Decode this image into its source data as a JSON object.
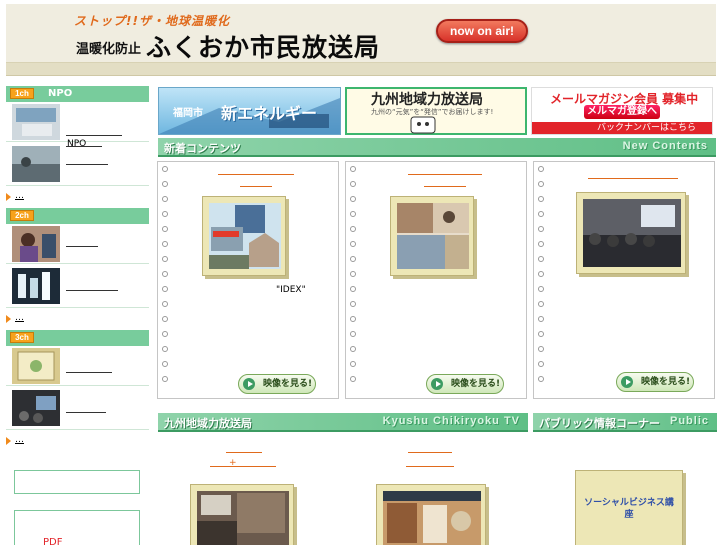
{
  "header": {
    "slogan_top": "ストップ!!ザ・地球温暖化",
    "slogan_lead": "温暖化防止",
    "site_title": "ふくおか市民放送局",
    "onair_label": "now on air!"
  },
  "sidebar": {
    "channels": [
      {
        "badge": "1ch",
        "label": "NPO",
        "items": [
          {
            "text": "NPO"
          },
          {
            "text": ""
          }
        ],
        "more": "…"
      },
      {
        "badge": "2ch",
        "label": "",
        "items": [
          {
            "text": ""
          },
          {
            "text": ""
          }
        ],
        "more": "…"
      },
      {
        "badge": "3ch",
        "label": "",
        "items": [
          {
            "text": ""
          },
          {
            "text": ""
          }
        ],
        "more": "…"
      }
    ],
    "box1_text": "",
    "box2_text": "PDF"
  },
  "banners": {
    "energy": {
      "city": "福岡市",
      "title": "新エネルギー"
    },
    "kyushu": {
      "title": "九州地域力放送局",
      "subtitle": "九州の“元気”を“発信”でお届けします!"
    },
    "mail": {
      "title": "メールマガジン会員 募集中",
      "button": "メルマガ登録へ",
      "backnumber": "バックナンバーはこちら"
    }
  },
  "new_contents": {
    "title_jp": "新着コンテンツ",
    "title_en": "New Contents",
    "cards": [
      {
        "caption": "\"IDEX\"",
        "watch_label": "映像を見る!"
      },
      {
        "caption": "",
        "watch_label": "映像を見る!"
      },
      {
        "caption": "",
        "watch_label": "映像を見る!"
      }
    ]
  },
  "kyushu_tv": {
    "title_jp": "九州地域力放送局",
    "title_en": "Kyushu Chikiryoku TV",
    "plus": "+"
  },
  "public_corner": {
    "title_jp": "パブリック情報コーナー",
    "title_en": "Public",
    "frame_text": "ソーシャルビジネス講座"
  },
  "colors": {
    "accent_green": "#78cc9c",
    "accent_orange": "#f7a21b",
    "link_orange": "#e06a1c"
  }
}
